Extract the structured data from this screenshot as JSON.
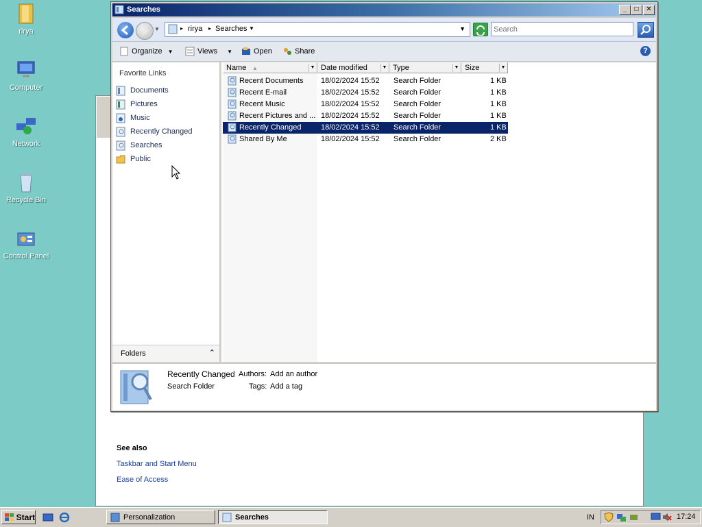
{
  "desktop": {
    "icons": [
      {
        "label": "rirya",
        "icon": "user-folder-icon"
      },
      {
        "label": "Computer",
        "icon": "computer-icon"
      },
      {
        "label": "Network",
        "icon": "network-icon"
      },
      {
        "label": "Recycle Bin",
        "icon": "recycle-bin-icon"
      },
      {
        "label": "Control Panel",
        "icon": "control-panel-icon"
      }
    ]
  },
  "background_window": {
    "see_also_label": "See also",
    "links": [
      "Taskbar and Start Menu",
      "Ease of Access"
    ]
  },
  "window": {
    "title": "Searches",
    "title_buttons": {
      "minimize": "_",
      "maximize": "□",
      "close": "✕"
    },
    "address": {
      "segments": [
        "rirya",
        "Searches"
      ]
    },
    "search": {
      "placeholder": "Search"
    },
    "toolbar": {
      "organize": "Organize",
      "views": "Views",
      "open": "Open",
      "share": "Share"
    },
    "nav": {
      "header": "Favorite Links",
      "items": [
        "Documents",
        "Pictures",
        "Music",
        "Recently Changed",
        "Searches",
        "Public"
      ],
      "folders_label": "Folders"
    },
    "columns": [
      "Name",
      "Date modified",
      "Type",
      "Size"
    ],
    "rows": [
      {
        "name": "Recent Documents",
        "date": "18/02/2024 15:52",
        "type": "Search Folder",
        "size": "1 KB"
      },
      {
        "name": "Recent E-mail",
        "date": "18/02/2024 15:52",
        "type": "Search Folder",
        "size": "1 KB"
      },
      {
        "name": "Recent Music",
        "date": "18/02/2024 15:52",
        "type": "Search Folder",
        "size": "1 KB"
      },
      {
        "name": "Recent Pictures and ...",
        "date": "18/02/2024 15:52",
        "type": "Search Folder",
        "size": "1 KB"
      },
      {
        "name": "Recently Changed",
        "date": "18/02/2024 15:52",
        "type": "Search Folder",
        "size": "1 KB",
        "selected": true
      },
      {
        "name": "Shared By Me",
        "date": "18/02/2024 15:52",
        "type": "Search Folder",
        "size": "2 KB"
      }
    ],
    "details": {
      "name": "Recently Changed",
      "kind": "Search Folder",
      "authors_label": "Authors:",
      "authors_value": "Add an author",
      "tags_label": "Tags:",
      "tags_value": "Add a tag"
    }
  },
  "taskbar": {
    "start_label": "Start",
    "tasks": [
      {
        "label": "Personalization",
        "active": false
      },
      {
        "label": "Searches",
        "active": true
      }
    ],
    "language": "IN",
    "clock": "17:24"
  },
  "colors": {
    "desktop": "#7ccbc6",
    "selection": "#0a246a",
    "title_start": "#0a246a",
    "link": "#1a3f9b"
  }
}
